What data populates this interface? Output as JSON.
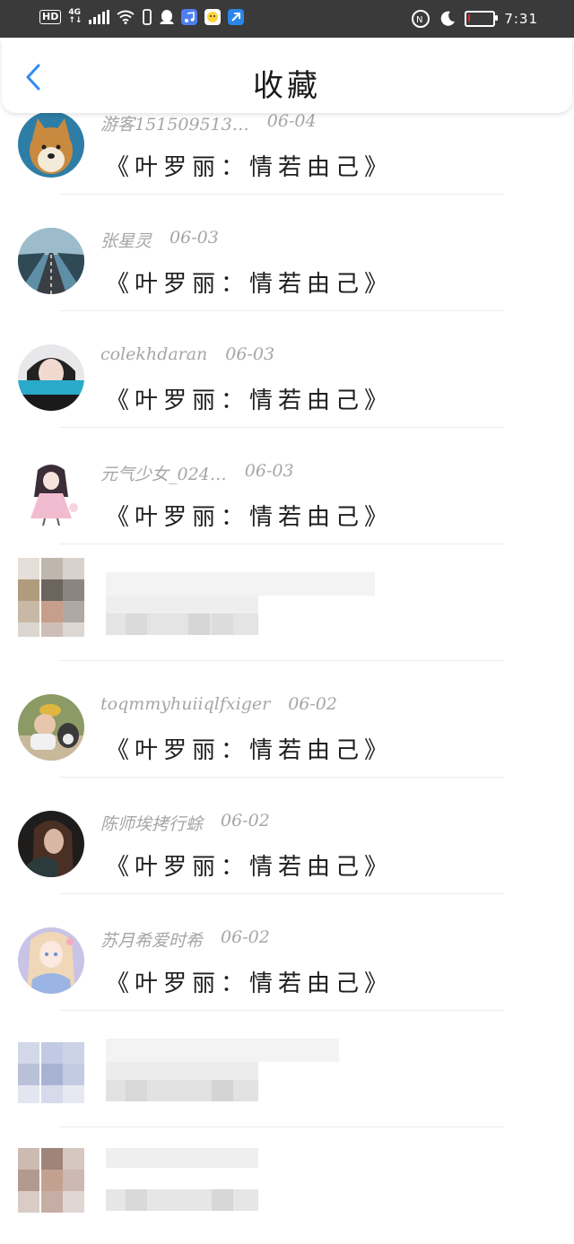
{
  "status_bar": {
    "hd": "HD",
    "network": "4G",
    "network_sub": "↑↓",
    "time": "7:31",
    "icons": [
      "signal-icon",
      "wifi-icon",
      "vibrate-icon",
      "qq-icon",
      "music-app-icon",
      "app-icon",
      "notification-app-icon",
      "nfc-icon",
      "moon-icon",
      "battery-icon"
    ],
    "battery_level": 0.08,
    "battery_color": "#e02b2b"
  },
  "header": {
    "title": "收藏",
    "back_icon": "chevron-left-icon",
    "accent": "#2f8cf2"
  },
  "items": [
    {
      "user": "游客151509513…",
      "date": "06-04",
      "book": "《叶罗丽：情若由己》",
      "avatar": "shiba-dog-avatar"
    },
    {
      "user": "张星灵",
      "date": "06-03",
      "book": "《叶罗丽：情若由己》",
      "avatar": "road-avatar"
    },
    {
      "user": "colekhdaran",
      "date": "06-03",
      "book": "《叶罗丽：情若由己》",
      "avatar": "girl-avatar"
    },
    {
      "user": "元气少女_024…",
      "date": "06-03",
      "book": "《叶罗丽：情若由己》",
      "avatar": "anime-doll-avatar"
    },
    {
      "user": "toqmmyhuiiqlfxiger",
      "date": "06-02",
      "book": "《叶罗丽：情若由己》",
      "avatar": "kid-dog-avatar"
    },
    {
      "user": "陈师埃拷行蜍",
      "date": "06-02",
      "book": "《叶罗丽：情若由己》",
      "avatar": "dark-portrait-avatar"
    },
    {
      "user": "苏月希爱时希",
      "date": "06-02",
      "book": "《叶罗丽：情若由己》",
      "avatar": "anime-girl-avatar"
    }
  ]
}
